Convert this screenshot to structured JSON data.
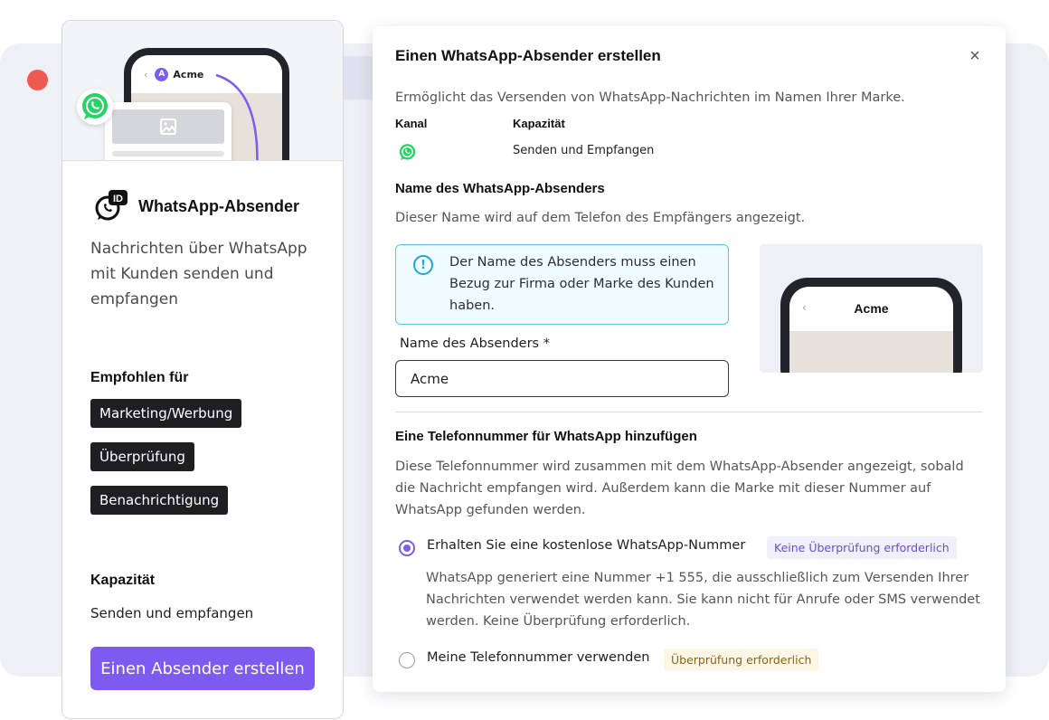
{
  "left_card": {
    "phone_contact": "Acme",
    "phone_avatar_letter": "A",
    "title": "WhatsApp-Absender",
    "description": "Nachrichten über WhatsApp mit Kunden senden und empfangen",
    "recommended_heading": "Empfohlen für",
    "tags": [
      "Marketing/Werbung",
      "Überprüfung",
      "Benachrichtigung"
    ],
    "capacity_heading": "Kapazität",
    "capacity_value": "Senden und empfangen",
    "create_button": "Einen Absender erstellen"
  },
  "modal": {
    "title": "Einen WhatsApp-Absender erstellen",
    "close_icon": "×",
    "intro": "Ermöglicht das Versenden von WhatsApp-Nachrichten im Namen Ihrer Marke.",
    "channel_label": "Kanal",
    "capacity_label": "Kapazität",
    "capacity_value": "Senden und Empfangen",
    "sender_name_section": {
      "heading": "Name des WhatsApp-Absenders",
      "description": "Dieser Name wird auf dem Telefon des Empfängers angezeigt.",
      "info": "Der Name des Absenders muss einen Bezug zur Firma oder Marke des Kunden haben.",
      "field_label": "Name des Absenders *",
      "field_value": "Acme",
      "preview_name": "Acme"
    },
    "phone_section": {
      "heading": "Eine Telefonnummer für WhatsApp hinzufügen",
      "description": "Diese Telefonnummer wird zusammen mit dem WhatsApp-Absender angezeigt, sobald die Nachricht empfangen wird. Außerdem kann die Marke mit dieser Nummer auf WhatsApp gefunden werden.",
      "option1_label": "Erhalten Sie eine kostenlose WhatsApp-Nummer",
      "option1_badge": "Keine Überprüfung erforderlich",
      "option1_description": "WhatsApp generiert eine Nummer +1 555, die ausschließlich zum Versenden Ihrer Nachrichten verwendet werden kann. Sie kann nicht für Anrufe oder SMS verwendet werden. Keine Überprüfung erforderlich.",
      "option2_label": "Meine Telefonnummer verwenden",
      "option2_badge": "Überprüfung erforderlich"
    }
  },
  "colors": {
    "accent": "#7f5af0",
    "whatsapp": "#25d366",
    "window_dot": "#ee5a52",
    "info_border": "#59c6ee"
  },
  "icons": [
    "whatsapp-icon",
    "image-icon",
    "sender-id-icon",
    "info-icon",
    "close-icon",
    "back-chevron-icon",
    "arrow-icon"
  ]
}
